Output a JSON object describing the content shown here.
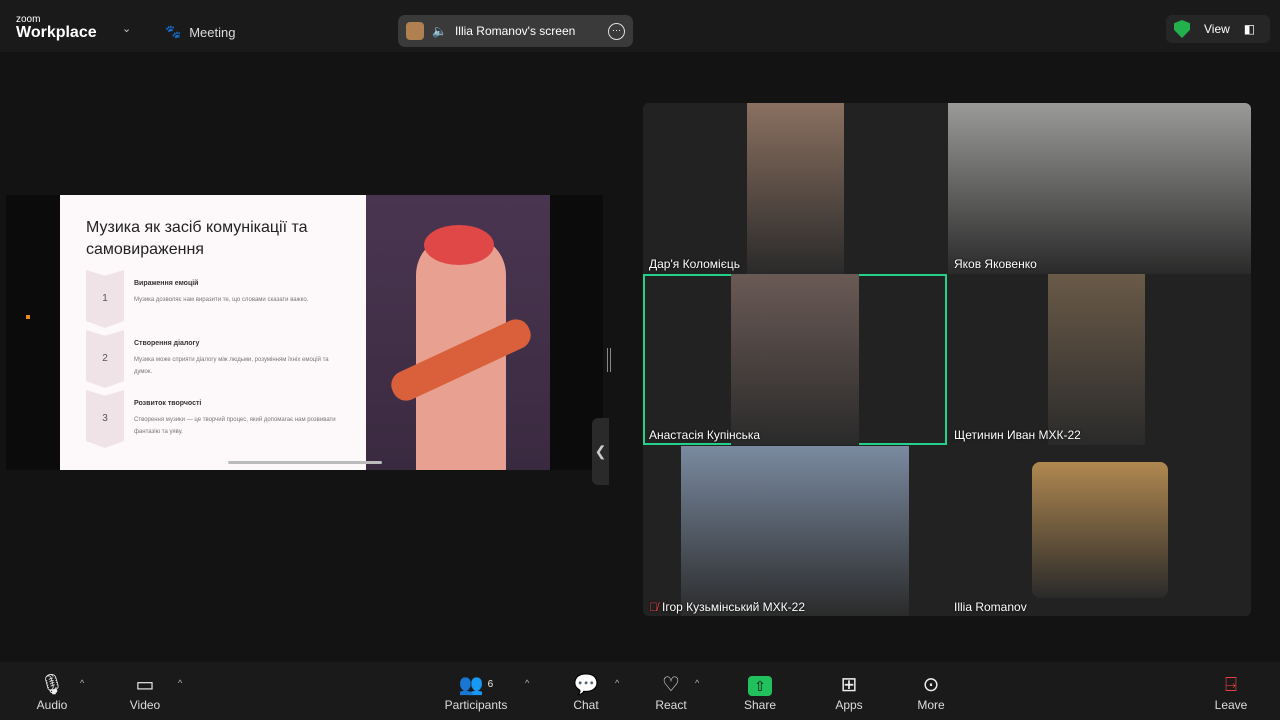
{
  "header": {
    "logo_small": "zoom",
    "logo_big": "Workplace",
    "meeting_label": "Meeting",
    "share_label": "Illia Romanov's screen",
    "view_label": "View"
  },
  "slide": {
    "title": "Музика як засіб комунікації та самовираження",
    "steps": [
      {
        "num": "1",
        "heading": "Вираження емоцій",
        "text": "Музика дозволяє нам виразити те, що словами сказати важко."
      },
      {
        "num": "2",
        "heading": "Створення діалогу",
        "text": "Музика може сприяти діалогу між людьми, розумінням їхніх емоцій та думок."
      },
      {
        "num": "3",
        "heading": "Розвиток творчості",
        "text": "Створення музики — це творчий процес, який допомагає нам розвивати фантазію та уяву."
      }
    ]
  },
  "participants": [
    {
      "name": "Дар'я Коломієць",
      "muted": false,
      "color": "#8a7060"
    },
    {
      "name": "Яков Яковенко",
      "muted": false,
      "color": "#9a9a98"
    },
    {
      "name": "Анастасія Купінська",
      "muted": false,
      "active": true,
      "color": "#6a5a55"
    },
    {
      "name": "Щетинин Иван МХК-22",
      "muted": false,
      "color": "#6a5a48"
    },
    {
      "name": "Ігор Кузьмінський МХК-22",
      "muted": true,
      "color": "#7a8aa0"
    },
    {
      "name": "Illia Romanov",
      "muted": false,
      "color": "#b08850"
    }
  ],
  "toolbar": {
    "audio": "Audio",
    "video": "Video",
    "participants": "Participants",
    "participants_count": "6",
    "chat": "Chat",
    "react": "React",
    "share": "Share",
    "apps": "Apps",
    "more": "More",
    "leave": "Leave"
  },
  "colors": {
    "active_speaker": "#23d18b",
    "share": "#21c25d",
    "secure": "#22b14c"
  }
}
